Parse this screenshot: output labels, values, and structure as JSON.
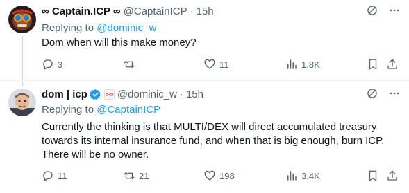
{
  "tweets": [
    {
      "display_name": "∞ Captain.ICP ∞",
      "handle": "@CaptainICP",
      "separator": "·",
      "time": "15h",
      "replying_prefix": "Replying to",
      "replying_to": "@dominic_w",
      "text": "Dom when will this make money?",
      "replies": "3",
      "retweets": "",
      "likes": "11",
      "views": "1.8K"
    },
    {
      "display_name": "dom | icp",
      "handle": "@dominic_w",
      "separator": "·",
      "time": "15h",
      "replying_prefix": "Replying to",
      "replying_to": "@CaptainICP",
      "text": "Currently the thinking is that MULTI/DEX will direct accumulated treasury towards its internal insurance fund, and when that is big enough, burn ICP. There will be no owner.",
      "replies": "11",
      "retweets": "21",
      "likes": "198",
      "views": "3.4K"
    }
  ],
  "icons": {
    "grok": "grok-icon",
    "more": "more-icon",
    "reply": "reply-icon",
    "retweet": "retweet-icon",
    "like": "heart-icon",
    "views": "views-icon",
    "bookmark": "bookmark-icon",
    "share": "share-icon",
    "verified": "verified-badge-icon"
  },
  "colors": {
    "link": "#1d9bf0",
    "muted": "#536471",
    "text": "#0f1419",
    "verified": "#1d9bf0"
  }
}
